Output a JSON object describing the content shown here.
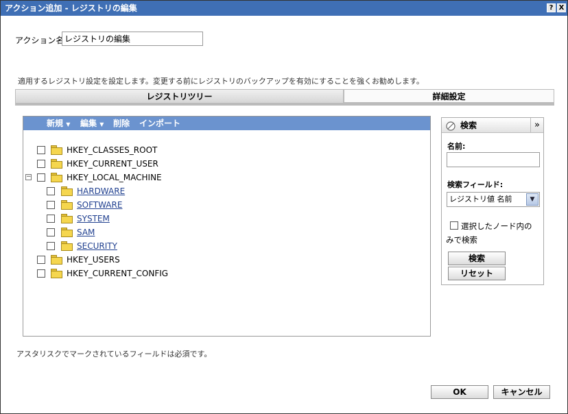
{
  "window": {
    "title": "アクション追加 - レジストリの編集",
    "help_label": "?",
    "close_label": "X"
  },
  "action": {
    "label": "アクション名",
    "value": "レジストリの編集"
  },
  "description": "適用するレジストリ設定を設定します。変更する前にレジストリのバックアップを有効にすることを強くお勧めします。",
  "tabs": [
    {
      "label": "レジストリツリー",
      "active": true
    },
    {
      "label": "詳細設定",
      "active": false
    }
  ],
  "toolbar": {
    "new_label": "新規",
    "edit_label": "編集",
    "delete_label": "削除",
    "import_label": "インポート"
  },
  "tree": {
    "roots": [
      {
        "label": "HKEY_CLASSES_ROOT"
      },
      {
        "label": "HKEY_CURRENT_USER"
      },
      {
        "label": "HKEY_LOCAL_MACHINE",
        "expanded": true,
        "expander": "−"
      },
      {
        "label": "HKEY_USERS"
      },
      {
        "label": "HKEY_CURRENT_CONFIG"
      }
    ],
    "children": [
      {
        "label": "HARDWARE"
      },
      {
        "label": "SOFTWARE"
      },
      {
        "label": "SYSTEM"
      },
      {
        "label": "SAM"
      },
      {
        "label": "SECURITY"
      }
    ]
  },
  "search": {
    "title": "検索",
    "collapse_label": "»",
    "name_label": "名前:",
    "name_value": "",
    "field_label": "検索フィールド:",
    "field_selected": "レジストリ値 名前",
    "scope_line1": "選択したノード内の",
    "scope_line2": "みで検索",
    "search_button": "検索",
    "reset_button": "リセット"
  },
  "required_note": "アスタリスクでマークされているフィールドは必須です。",
  "footer": {
    "ok_label": "OK",
    "cancel_label": "キャンセル"
  },
  "colors": {
    "titlebar": "#3f6fb5",
    "toolbar": "#6b93cf",
    "link": "#1f3f8f"
  }
}
